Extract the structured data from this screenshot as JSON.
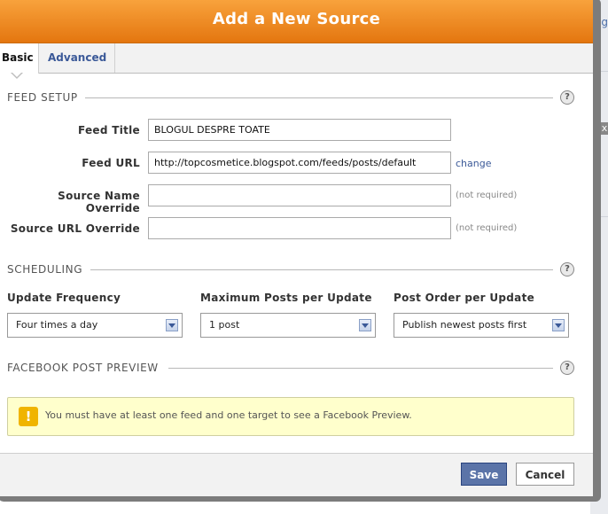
{
  "dialog": {
    "title": "Add a New Source"
  },
  "tabs": [
    {
      "label": "Basic",
      "active": true
    },
    {
      "label": "Advanced",
      "active": false
    }
  ],
  "background": {
    "fragment_text": "ing",
    "close_glyph": "x"
  },
  "sections": {
    "feed_setup": "FEED SETUP",
    "scheduling": "SCHEDULING",
    "facebook_preview": "FACEBOOK POST PREVIEW"
  },
  "help_glyph": "?",
  "feed_setup": {
    "feed_title": {
      "label": "Feed Title",
      "value": "BLOGUL DESPRE TOATE"
    },
    "feed_url": {
      "label": "Feed URL",
      "value": "http://topcosmetice.blogspot.com/feeds/posts/default",
      "link": "change"
    },
    "source_name_override": {
      "label": "Source Name Override",
      "value": "",
      "hint": "(not required)"
    },
    "source_url_override": {
      "label": "Source URL Override",
      "value": "",
      "hint": "(not required)"
    }
  },
  "scheduling": {
    "update_frequency": {
      "label": "Update Frequency",
      "selected": "Four times a day"
    },
    "max_posts": {
      "label": "Maximum Posts per Update",
      "selected": "1 post"
    },
    "post_order": {
      "label": "Post Order per Update",
      "selected": "Publish newest posts first"
    }
  },
  "preview": {
    "warning_glyph": "!",
    "message": "You must have at least one feed and one target to see a Facebook Preview."
  },
  "footer": {
    "save_label": "Save",
    "cancel_label": "Cancel"
  },
  "colors": {
    "title_bar": "#f08a24",
    "link": "#3b5998",
    "save_button": "#5b74a8",
    "notice_bg": "#ffffcc"
  }
}
